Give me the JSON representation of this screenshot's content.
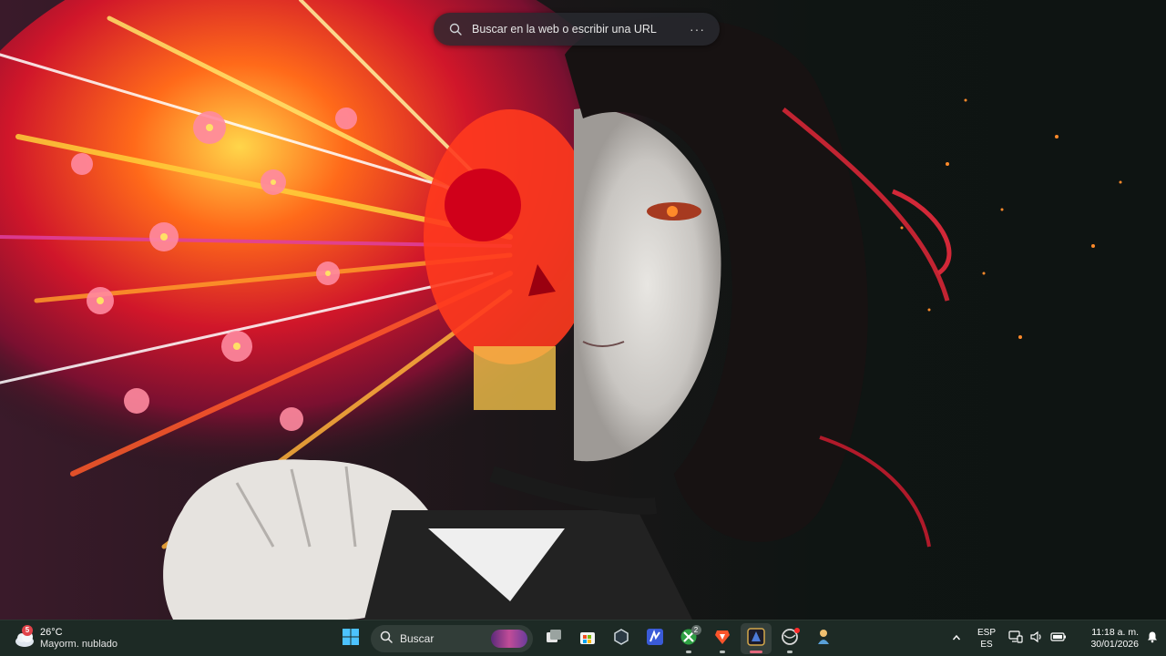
{
  "search_widget": {
    "placeholder": "Buscar en la web o escribir una URL",
    "more_label": "···",
    "icons": [
      "search-icon",
      "more-options-icon"
    ]
  },
  "weather": {
    "temperature": "26°C",
    "description": "Mayorm. nublado",
    "badge": "5",
    "icon": "cloud-icon"
  },
  "taskbar": {
    "search_label": "Buscar",
    "apps": [
      {
        "name": "start",
        "icon": "windows-start-icon"
      },
      {
        "name": "task-view",
        "icon": "task-view-icon"
      },
      {
        "name": "store",
        "icon": "store-icon"
      },
      {
        "name": "app-hexagon",
        "icon": "hexagon-app-icon"
      },
      {
        "name": "app-m",
        "icon": "m-app-icon"
      },
      {
        "name": "xbox",
        "icon": "xbox-icon",
        "badge": "2"
      },
      {
        "name": "brave",
        "icon": "brave-browser-icon"
      },
      {
        "name": "wallpaper-engine",
        "icon": "wallpaper-app-icon",
        "active": true
      },
      {
        "name": "app-red-dot",
        "icon": "circle-app-icon",
        "notification": true
      },
      {
        "name": "app-figure",
        "icon": "figure-app-icon"
      }
    ]
  },
  "tray": {
    "language_line1": "ESP",
    "language_line2": "ES",
    "time": "11:18 a. m.",
    "date": "30/01/2026",
    "icons": [
      "chevron-up-icon",
      "network-icon",
      "volume-icon",
      "battery-icon",
      "notification-bell-icon"
    ]
  },
  "colors": {
    "taskbar_bg": "#1d2a25",
    "accent_active": "#e2687d",
    "wallpaper_dark": "#101614"
  }
}
